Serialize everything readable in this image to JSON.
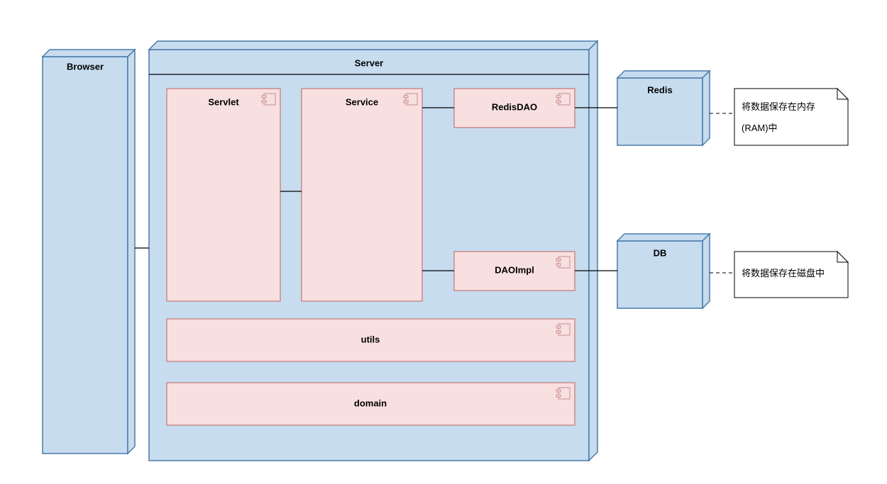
{
  "diagram": {
    "browser": "Browser",
    "server": "Server",
    "servlet": "Servlet",
    "service": "Service",
    "redisDAO": "RedisDAO",
    "daoImpl": "DAOImpl",
    "utils": "utils",
    "domain": "domain",
    "redis": "Redis",
    "db": "DB",
    "note_redis_l1": "将数据保存在内存",
    "note_redis_l2": "(RAM)中",
    "note_db": "将数据保存在磁盘中"
  }
}
